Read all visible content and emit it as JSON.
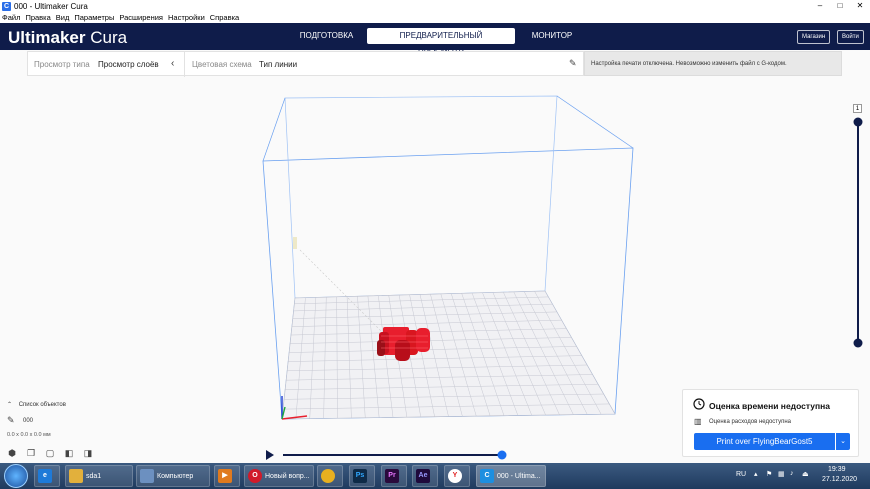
{
  "window": {
    "title": "000 - Ultimaker Cura",
    "controls": [
      "–",
      "□",
      "✕"
    ]
  },
  "menu": [
    "Файл",
    "Правка",
    "Вид",
    "Параметры",
    "Расширения",
    "Настройки",
    "Справка"
  ],
  "header": {
    "logo_bold": "Ultimaker",
    "logo_light": "Cura",
    "tabs": [
      "ПОДГОТОВКА",
      "ПРЕДВАРИТЕЛЬНЫЙ ПРОСМОТР",
      "МОНИТОР"
    ],
    "active_tab": 1,
    "marketplace": "Магазин",
    "signin": "Войти"
  },
  "viewbar": {
    "view_type_label": "Просмотр типа",
    "view_type_value": "Просмотр слоёв",
    "color_scheme_label": "Цветовая схема",
    "color_scheme_value": "Тип линии"
  },
  "notice": "Настройка печати отключена. Невозможно изменить файл с G-кодом.",
  "layer_slider": {
    "top_label": "1"
  },
  "objects": {
    "list_label": "Список объектов",
    "name": "000",
    "dimensions": "0.0 x 0.0 x 0.0 мм"
  },
  "estimate": {
    "time": "Оценка времени недоступна",
    "material": "Оценка расходов недоступна",
    "print_button": "Print over FlyingBearGost5"
  },
  "taskbar": {
    "items": [
      "sda1",
      "Компьютер",
      "Новый вопр...",
      "000 - Ultima..."
    ],
    "lang": "RU",
    "time": "19:39",
    "date": "27.12.2020"
  },
  "colors": {
    "header_bg": "#0f1c4a",
    "accent": "#196ef0",
    "model": "#e81e2d",
    "volume_outline": "#4a90e2"
  }
}
